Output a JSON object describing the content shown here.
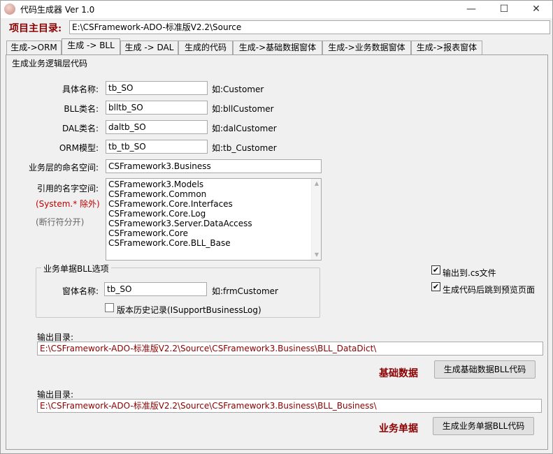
{
  "window": {
    "title": "代码生成器 Ver 1.0",
    "minimize": "—",
    "maximize": "☐",
    "close": "✕"
  },
  "project": {
    "label": "项目主目录:",
    "path": "E:\\CSFramework-ADO-标准版V2.2\\Source"
  },
  "tabs": [
    {
      "label": "生成->ORM"
    },
    {
      "label": "生成 -> BLL"
    },
    {
      "label": "生成 -> DAL"
    },
    {
      "label": "生成的代码"
    },
    {
      "label": "生成->基础数据窗体"
    },
    {
      "label": "生成->业务数据窗体"
    },
    {
      "label": "生成->报表窗体"
    }
  ],
  "panel": {
    "title": "生成业务逻辑层代码",
    "fields": {
      "name": {
        "label": "具体名称:",
        "value": "tb_SO",
        "hint": "如:Customer"
      },
      "bll": {
        "label": "BLL类名:",
        "value": "blltb_SO",
        "hint": "如:bllCustomer"
      },
      "dal": {
        "label": "DAL类名:",
        "value": "daltb_SO",
        "hint": "如:dalCustomer"
      },
      "orm": {
        "label": "ORM模型:",
        "value": "tb_tb_SO",
        "hint": "如:tb_Customer"
      },
      "ns": {
        "label": "业务层的命名空间:",
        "value": "CSFramework3.Business"
      }
    },
    "refs": {
      "label": "引用的名字空间:",
      "note_red": "(System.* 除外)",
      "note_gray": "(断行符分开)",
      "items": [
        "CSFramework3.Models",
        "CSFramework.Common",
        "CSFramework.Core.Interfaces",
        "CSFramework.Core.Log",
        "CSFramework3.Server.DataAccess",
        "CSFramework.Core",
        "CSFramework.Core.BLL_Base"
      ]
    },
    "group": {
      "title": "业务单据BLL选项",
      "form_label": "窗体名称:",
      "form_value": "tb_SO",
      "form_hint": "如:frmCustomer",
      "history_label": "版本历史记录(ISupportBusinessLog)",
      "history_checked": false
    },
    "options": {
      "output_cs": "输出到.cs文件",
      "output_cs_checked": true,
      "jump_preview": "生成代码后跳到预览页面",
      "jump_preview_checked": true
    },
    "basic": {
      "output_label": "输出目录:",
      "path": "E:\\CSFramework-ADO-标准版V2.2\\Source\\CSFramework3.Business\\BLL_DataDict\\",
      "section_label": "基础数据",
      "button": "生成基础数据BLL代码"
    },
    "business": {
      "output_label": "输出目录:",
      "path": "E:\\CSFramework-ADO-标准版V2.2\\Source\\CSFramework3.Business\\BLL_Business\\",
      "section_label": "业务单据",
      "button": "生成业务单据BLL代码"
    }
  },
  "colors": {
    "accent_red": "#8b0000",
    "note_red": "#c00000",
    "window_bg": "#f0f0f0"
  }
}
